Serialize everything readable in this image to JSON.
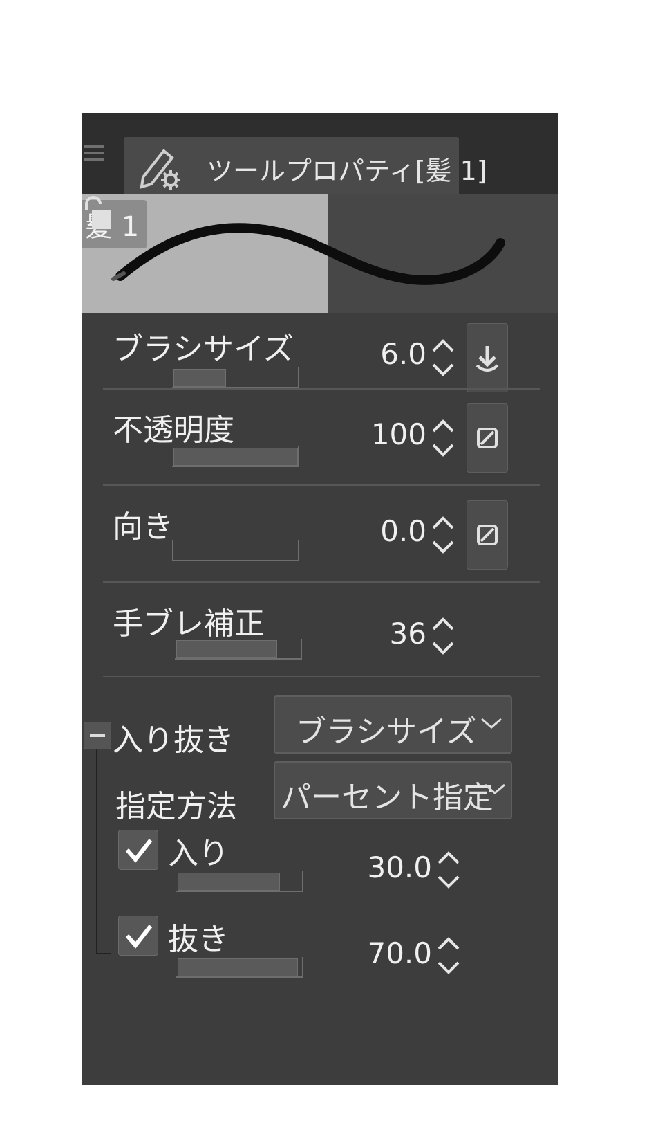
{
  "panel": {
    "tab_title": "ツールプロパティ[髪 1]",
    "preview_label": "髪 1"
  },
  "properties": [
    {
      "label": "ブラシサイズ",
      "value": "6.0",
      "fill": 0.43,
      "button": "download-icon"
    },
    {
      "label": "不透明度",
      "value": "100",
      "fill": 1.0,
      "button": "no-pressure-icon"
    },
    {
      "label": "向き",
      "value": "0.0",
      "fill": 0.0,
      "button": "no-pressure-icon"
    },
    {
      "label": "手ブレ補正",
      "value": "36",
      "fill": 0.8
    }
  ],
  "taper": {
    "label": "入り抜き",
    "target_select": "ブラシサイズ",
    "method_label": "指定方法",
    "method_select": "パーセント指定",
    "start": {
      "label": "入り",
      "value": "30.0",
      "checked": true,
      "fill": 0.82
    },
    "end": {
      "label": "抜き",
      "value": "70.0",
      "checked": true,
      "fill": 0.96
    }
  }
}
